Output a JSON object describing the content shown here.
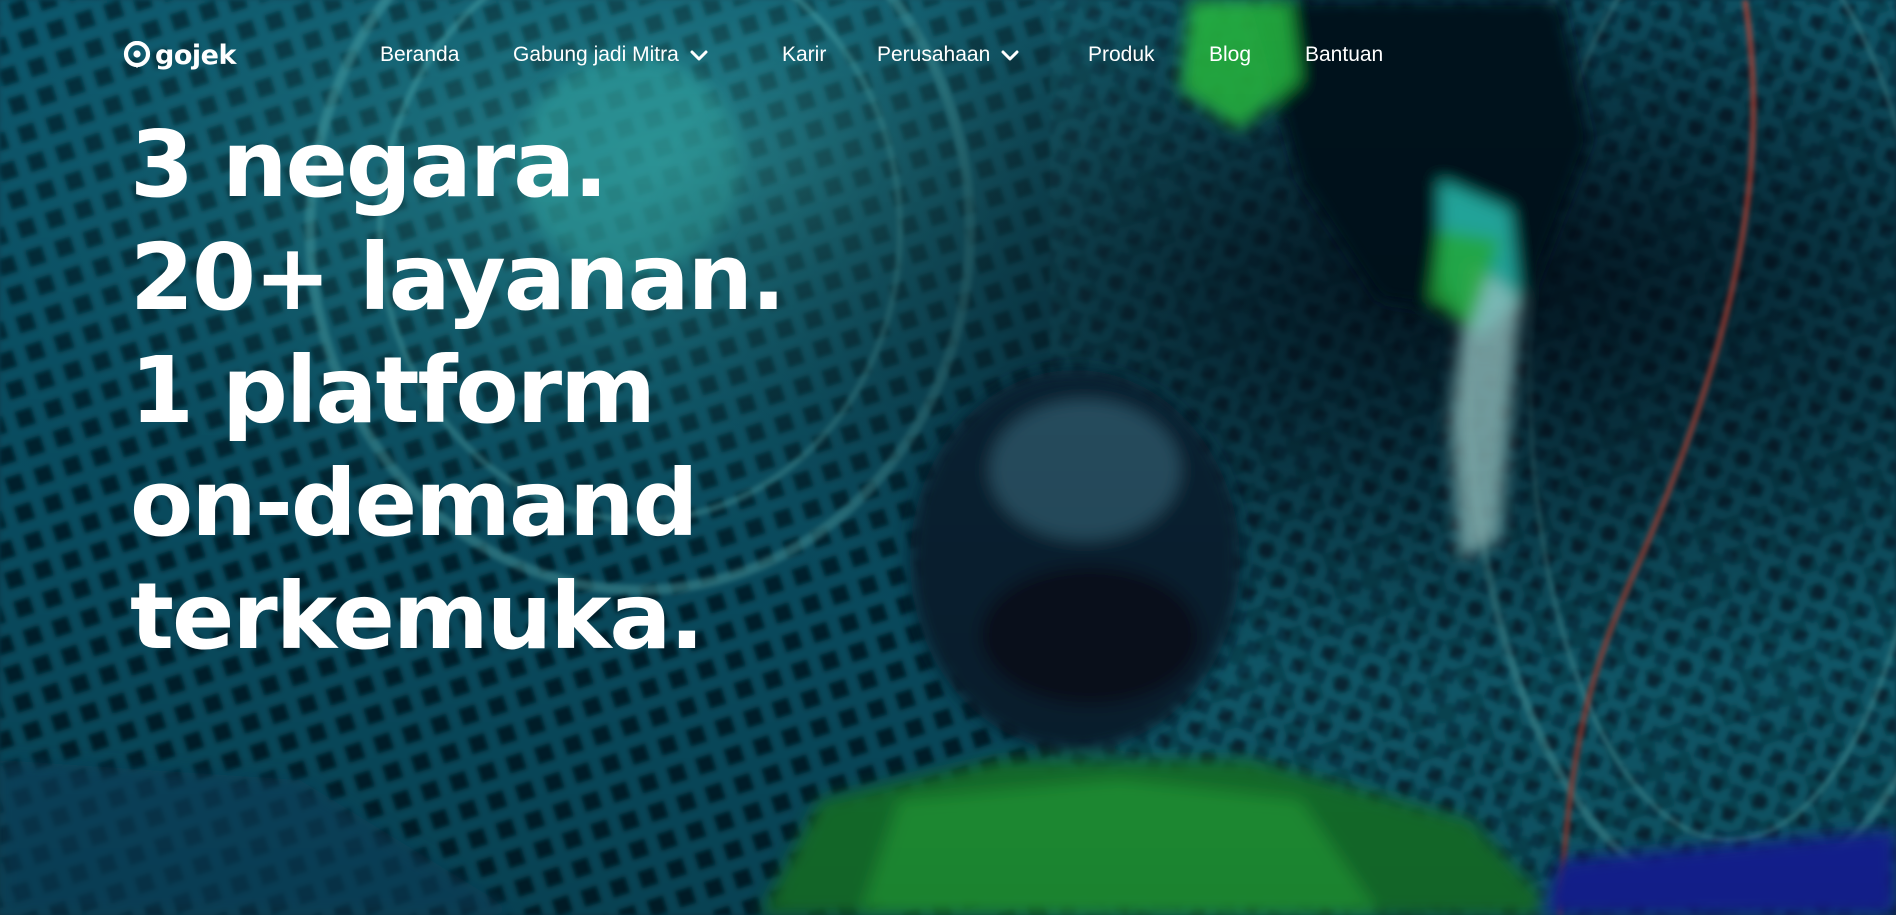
{
  "brand": {
    "name": "gojek"
  },
  "nav": {
    "items": [
      {
        "label": "Beranda",
        "has_dropdown": false
      },
      {
        "label": "Gabung jadi Mitra",
        "has_dropdown": true
      },
      {
        "label": "Karir",
        "has_dropdown": false
      },
      {
        "label": "Perusahaan",
        "has_dropdown": true
      },
      {
        "label": "Produk",
        "has_dropdown": false
      },
      {
        "label": "Blog",
        "has_dropdown": false
      },
      {
        "label": "Bantuan",
        "has_dropdown": false
      }
    ],
    "dropdown_icon": "chevron-down-icon"
  },
  "hero": {
    "headline_lines": [
      "3 negara.",
      "20+ layanan.",
      "1 platform",
      "on-demand",
      "terkemuka."
    ]
  },
  "colors": {
    "text": "#ffffff",
    "background_teal": "#0b5f78",
    "background_dark": "#031a2a",
    "accent_green": "#28c84a",
    "accent_cyan": "#2fd6d0"
  }
}
